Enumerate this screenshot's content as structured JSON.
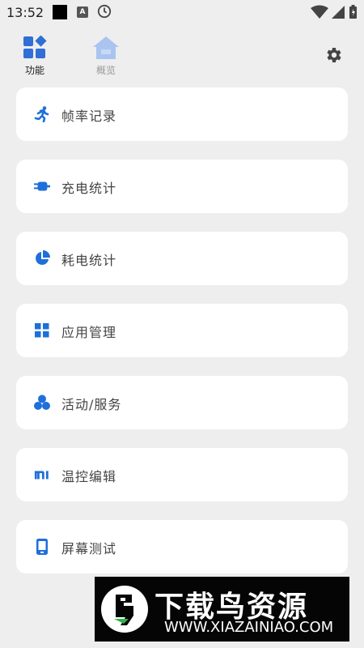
{
  "status_bar": {
    "time": "13:52",
    "badge_letter": "A",
    "icons": [
      "notification-square-icon",
      "a-badge-icon",
      "clock-icon",
      "wifi-icon",
      "signal-icon",
      "battery-icon"
    ]
  },
  "tabs": [
    {
      "label": "功能",
      "icon": "functions-icon",
      "active": true
    },
    {
      "label": "概览",
      "icon": "home-icon",
      "active": false
    }
  ],
  "settings": {
    "icon": "gear-icon"
  },
  "menu": [
    {
      "label": "帧率记录",
      "icon": "running-person-icon"
    },
    {
      "label": "充电统计",
      "icon": "charger-icon"
    },
    {
      "label": "耗电统计",
      "icon": "pie-chart-icon"
    },
    {
      "label": "应用管理",
      "icon": "grid-icon"
    },
    {
      "label": "活动/服务",
      "icon": "circles-icon"
    },
    {
      "label": "温控编辑",
      "icon": "mi-logo-icon"
    },
    {
      "label": "屏幕测试",
      "icon": "phone-screen-icon"
    }
  ],
  "watermark": {
    "title": "下载鸟资源",
    "url": "WWW.XIAZAINIAO.COM"
  },
  "colors": {
    "accent": "#1e6fd9",
    "tab_icon_active": "#2f6fd6",
    "tab_icon_inactive": "#a9c4ef",
    "background": "#eeeeee",
    "card": "#ffffff"
  }
}
